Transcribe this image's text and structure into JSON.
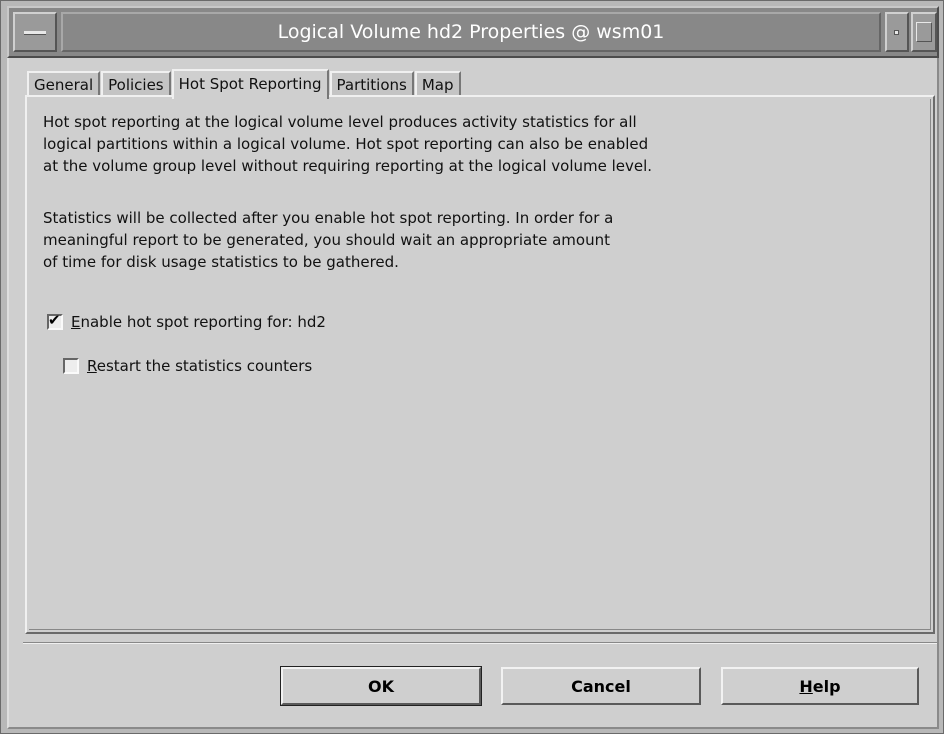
{
  "window": {
    "title": "Logical Volume hd2 Properties @ wsm01"
  },
  "tabs": [
    {
      "label": "General",
      "active": false
    },
    {
      "label": "Policies",
      "active": false
    },
    {
      "label": "Hot Spot Reporting",
      "active": true
    },
    {
      "label": "Partitions",
      "active": false
    },
    {
      "label": "Map",
      "active": false
    }
  ],
  "content": {
    "paragraph1": "Hot spot reporting at the logical volume level produces activity statistics for all\nlogical partitions within a logical volume. Hot spot reporting can also be enabled\nat the volume group level without requiring reporting at the logical volume level.",
    "paragraph2": "Statistics will be collected after you enable hot spot reporting. In order for a\nmeaningful report to be generated, you should wait an appropriate amount\nof time for disk usage statistics to be gathered.",
    "enable_checkbox": {
      "mnemonic": "E",
      "label_rest": "nable hot spot reporting for: hd2",
      "checked": true,
      "check_glyph": "✔"
    },
    "restart_checkbox": {
      "mnemonic": "R",
      "label_rest": "estart the statistics counters",
      "checked": false
    }
  },
  "buttons": {
    "ok": "OK",
    "cancel": "Cancel",
    "help_mnemonic": "H",
    "help_rest": "elp"
  }
}
